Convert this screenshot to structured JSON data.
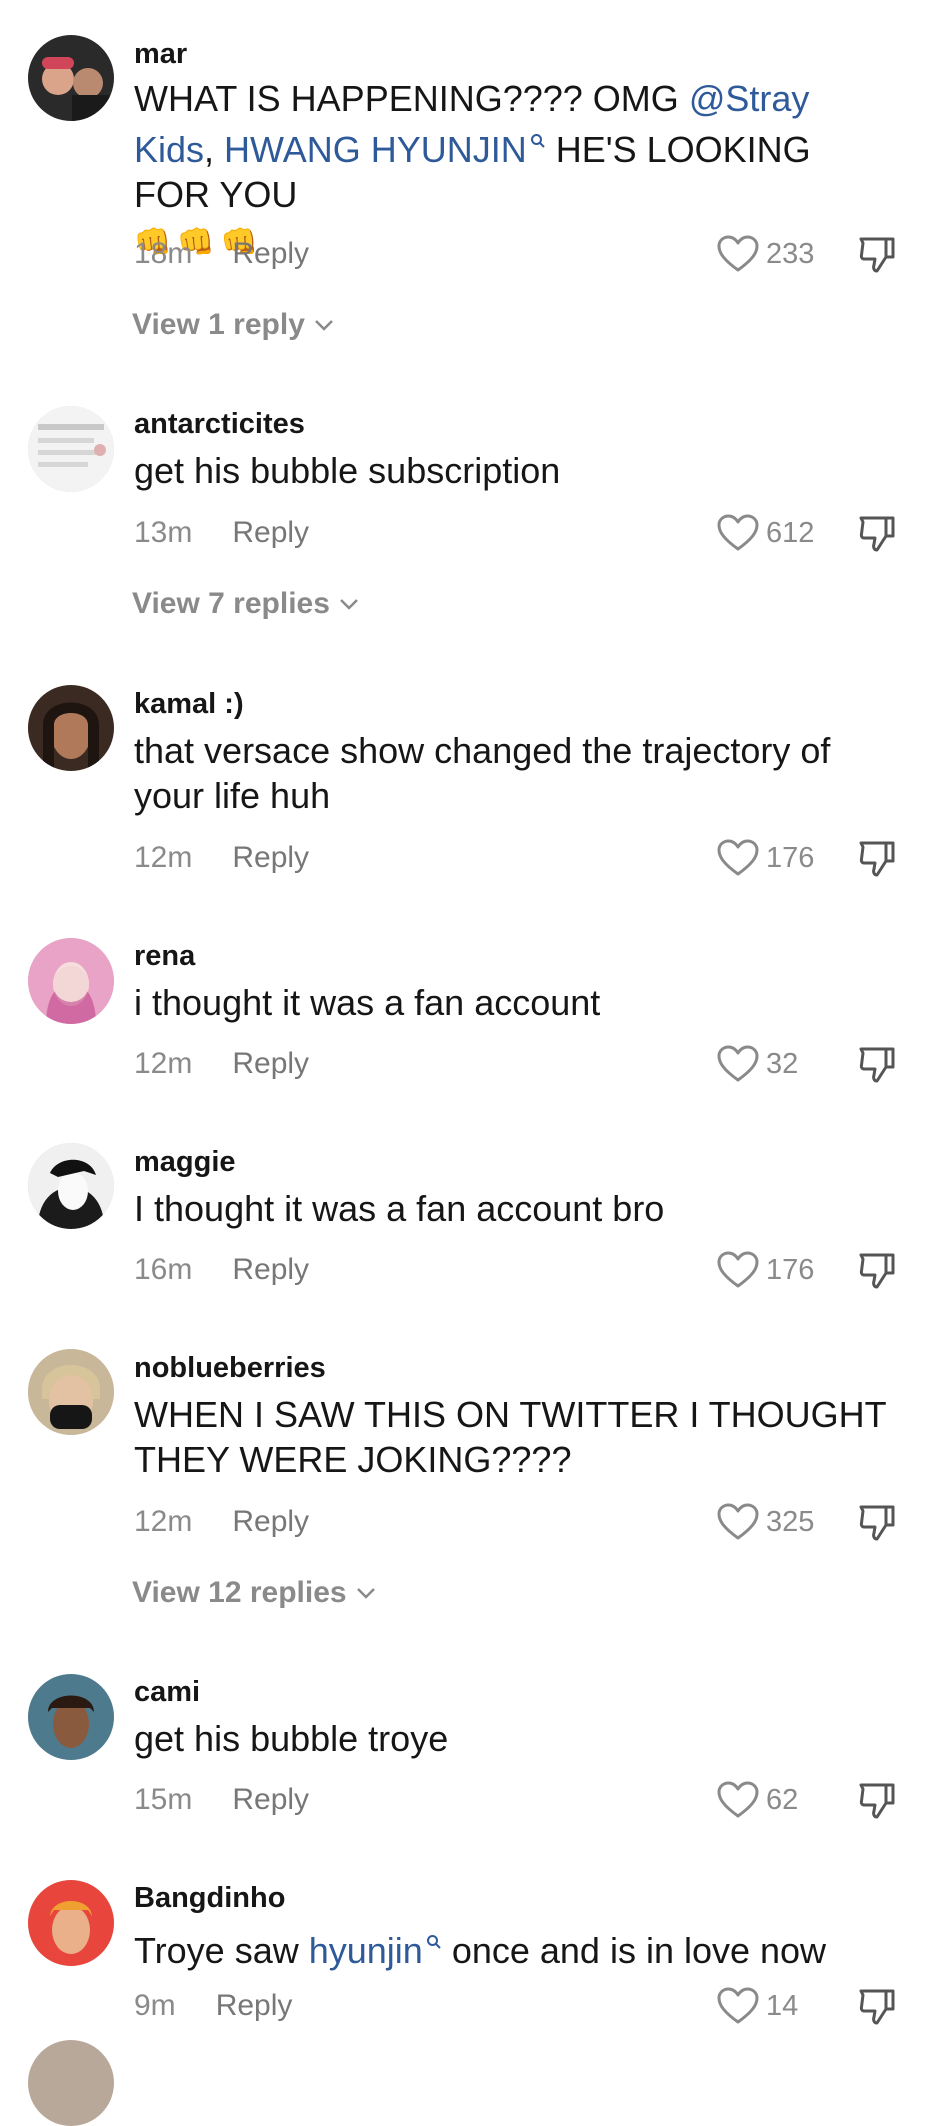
{
  "comments": [
    {
      "username": "mar",
      "text_parts": [
        "WHAT IS HAPPENING???? OMG ",
        "@Stray Kids",
        ", ",
        "HWANG HYUNJIN",
        " HE'S LOOKING FOR YOU"
      ],
      "emoji": "👊👊👊",
      "time": "18m",
      "reply_label": "Reply",
      "likes": "233",
      "view_replies": "View 1 reply"
    },
    {
      "username": "antarcticites",
      "text": "get his bubble subscription",
      "time": "13m",
      "reply_label": "Reply",
      "likes": "612",
      "view_replies": "View 7 replies"
    },
    {
      "username": "kamal :)",
      "text": "that versace show changed the trajectory of your life huh",
      "time": "12m",
      "reply_label": "Reply",
      "likes": "176"
    },
    {
      "username": "rena",
      "text": "i thought it was a fan account",
      "time": "12m",
      "reply_label": "Reply",
      "likes": "32"
    },
    {
      "username": "maggie",
      "text": "I thought it was a fan account bro",
      "time": "16m",
      "reply_label": "Reply",
      "likes": "176"
    },
    {
      "username": "noblueberries",
      "text": "WHEN I SAW THIS ON TWITTER I THOUGHT THEY WERE JOKING????",
      "time": "12m",
      "reply_label": "Reply",
      "likes": "325",
      "view_replies": "View 12 replies"
    },
    {
      "username": "cami",
      "text": "get his bubble troye",
      "time": "15m",
      "reply_label": "Reply",
      "likes": "62"
    },
    {
      "username": "Bangdinho",
      "text_parts": [
        "Troye saw ",
        "hyunjin",
        " once and is in love now"
      ],
      "time": "9m",
      "reply_label": "Reply",
      "likes": "14"
    }
  ],
  "icons": {
    "like": "heart-outline-icon",
    "dislike": "thumbs-down-outline-icon",
    "expand": "chevron-down-icon",
    "search": "search-icon"
  },
  "colors": {
    "mention": "#2f5a9a",
    "muted": "#8a8a8a",
    "text": "#161616"
  }
}
